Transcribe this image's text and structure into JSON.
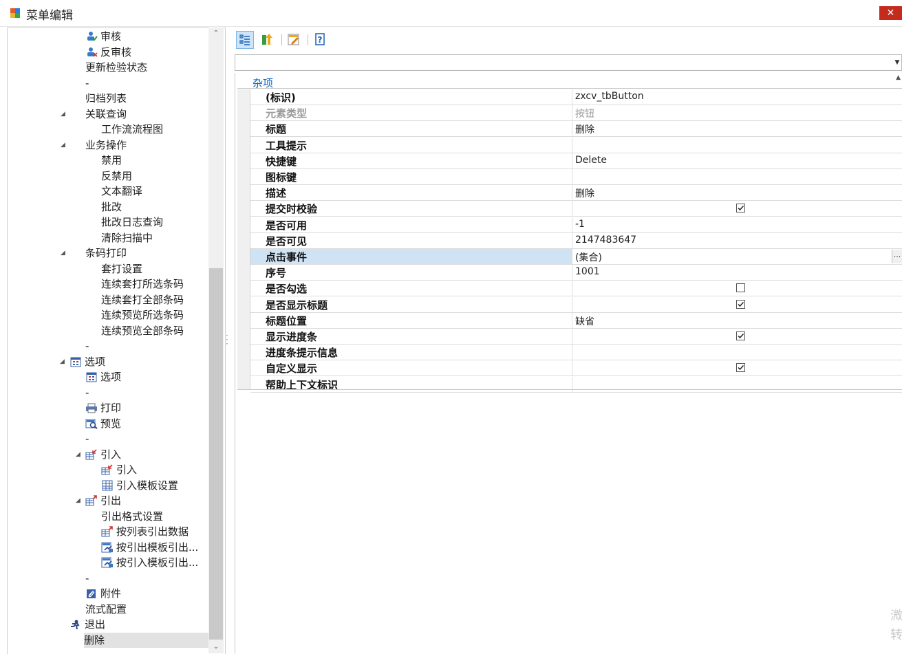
{
  "window": {
    "title": "菜单编辑",
    "close_label": "✕"
  },
  "tree": {
    "items": [
      {
        "label": "审核",
        "indent": 2,
        "icon": "user-check-icon",
        "expander": ""
      },
      {
        "label": "反审核",
        "indent": 2,
        "icon": "user-uncheck-icon",
        "expander": ""
      },
      {
        "label": "更新检验状态",
        "indent": 2,
        "icon": "",
        "expander": ""
      },
      {
        "label": "-",
        "indent": 2,
        "icon": "",
        "expander": ""
      },
      {
        "label": "归档列表",
        "indent": 2,
        "icon": "",
        "expander": ""
      },
      {
        "label": "关联查询",
        "indent": 2,
        "icon": "",
        "expander": "◢"
      },
      {
        "label": "工作流流程图",
        "indent": 3,
        "icon": "",
        "expander": ""
      },
      {
        "label": "业务操作",
        "indent": 2,
        "icon": "",
        "expander": "◢"
      },
      {
        "label": "禁用",
        "indent": 3,
        "icon": "",
        "expander": ""
      },
      {
        "label": "反禁用",
        "indent": 3,
        "icon": "",
        "expander": ""
      },
      {
        "label": "文本翻译",
        "indent": 3,
        "icon": "",
        "expander": ""
      },
      {
        "label": "批改",
        "indent": 3,
        "icon": "",
        "expander": ""
      },
      {
        "label": "批改日志查询",
        "indent": 3,
        "icon": "",
        "expander": ""
      },
      {
        "label": "清除扫描中",
        "indent": 3,
        "icon": "",
        "expander": ""
      },
      {
        "label": "条码打印",
        "indent": 2,
        "icon": "",
        "expander": "◢"
      },
      {
        "label": "套打设置",
        "indent": 3,
        "icon": "",
        "expander": ""
      },
      {
        "label": "连续套打所选条码",
        "indent": 3,
        "icon": "",
        "expander": ""
      },
      {
        "label": "连续套打全部条码",
        "indent": 3,
        "icon": "",
        "expander": ""
      },
      {
        "label": "连续预览所选条码",
        "indent": 3,
        "icon": "",
        "expander": ""
      },
      {
        "label": "连续预览全部条码",
        "indent": 3,
        "icon": "",
        "expander": ""
      },
      {
        "label": "-",
        "indent": 2,
        "icon": "",
        "expander": ""
      },
      {
        "label": "选项",
        "indent": 1,
        "icon": "calendar-icon",
        "expander": "◢"
      },
      {
        "label": "选项",
        "indent": 2,
        "icon": "calendar-icon",
        "expander": ""
      },
      {
        "label": "-",
        "indent": 2,
        "icon": "",
        "expander": ""
      },
      {
        "label": "打印",
        "indent": 2,
        "icon": "printer-icon",
        "expander": ""
      },
      {
        "label": "预览",
        "indent": 2,
        "icon": "preview-icon",
        "expander": ""
      },
      {
        "label": "-",
        "indent": 2,
        "icon": "",
        "expander": ""
      },
      {
        "label": "引入",
        "indent": 2,
        "icon": "import-icon",
        "expander": "◢"
      },
      {
        "label": "引入",
        "indent": 3,
        "icon": "import-icon",
        "expander": ""
      },
      {
        "label": "引入模板设置",
        "indent": 3,
        "icon": "table-icon",
        "expander": ""
      },
      {
        "label": "引出",
        "indent": 2,
        "icon": "export-icon",
        "expander": "◢"
      },
      {
        "label": "引出格式设置",
        "indent": 3,
        "icon": "",
        "expander": ""
      },
      {
        "label": "按列表引出数据",
        "indent": 3,
        "icon": "export-icon",
        "expander": ""
      },
      {
        "label": "按引出模板引出...",
        "indent": 3,
        "icon": "template-export-icon",
        "expander": ""
      },
      {
        "label": "按引入模板引出...",
        "indent": 3,
        "icon": "template-export-icon",
        "expander": ""
      },
      {
        "label": "-",
        "indent": 2,
        "icon": "",
        "expander": ""
      },
      {
        "label": "附件",
        "indent": 2,
        "icon": "attachment-icon",
        "expander": ""
      },
      {
        "label": "流式配置",
        "indent": 2,
        "icon": "",
        "expander": ""
      },
      {
        "label": "退出",
        "indent": 1,
        "icon": "exit-icon",
        "expander": ""
      },
      {
        "label": "删除",
        "indent": 2,
        "icon": "",
        "expander": "",
        "selected": true
      }
    ]
  },
  "property_grid": {
    "toolbar": [
      {
        "name": "categorized-icon",
        "active": true
      },
      {
        "name": "alphabetical-icon",
        "active": false
      },
      {
        "name": "property-pages-icon",
        "active": false
      },
      {
        "name": "help-icon",
        "active": false
      }
    ],
    "object_selector_value": "",
    "category": "杂项",
    "rows": [
      {
        "name": "(标识)",
        "value": "zxcv_tbButton",
        "type": "text"
      },
      {
        "name": "元素类型",
        "value": "按钮",
        "type": "text",
        "disabled": true
      },
      {
        "name": "标题",
        "value": "删除",
        "type": "text"
      },
      {
        "name": "工具提示",
        "value": "",
        "type": "text"
      },
      {
        "name": "快捷键",
        "value": "Delete",
        "type": "text"
      },
      {
        "name": "图标键",
        "value": "",
        "type": "text"
      },
      {
        "name": "描述",
        "value": "删除",
        "type": "text"
      },
      {
        "name": "提交时校验",
        "value": true,
        "type": "checkbox"
      },
      {
        "name": "是否可用",
        "value": "-1",
        "type": "text"
      },
      {
        "name": "是否可见",
        "value": "2147483647",
        "type": "text"
      },
      {
        "name": "点击事件",
        "value": "(集合)",
        "type": "text",
        "selected": true,
        "ellipsis": "..."
      },
      {
        "name": "序号",
        "value": "1001",
        "type": "text"
      },
      {
        "name": "是否勾选",
        "value": false,
        "type": "checkbox"
      },
      {
        "name": "是否显示标题",
        "value": true,
        "type": "checkbox"
      },
      {
        "name": "标题位置",
        "value": "缺省",
        "type": "text"
      },
      {
        "name": "显示进度条",
        "value": true,
        "type": "checkbox"
      },
      {
        "name": "进度条提示信息",
        "value": "",
        "type": "text"
      },
      {
        "name": "自定义显示",
        "value": true,
        "type": "checkbox"
      },
      {
        "name": "帮助上下文标识",
        "value": "",
        "type": "text"
      }
    ]
  },
  "watermark": "溦转"
}
